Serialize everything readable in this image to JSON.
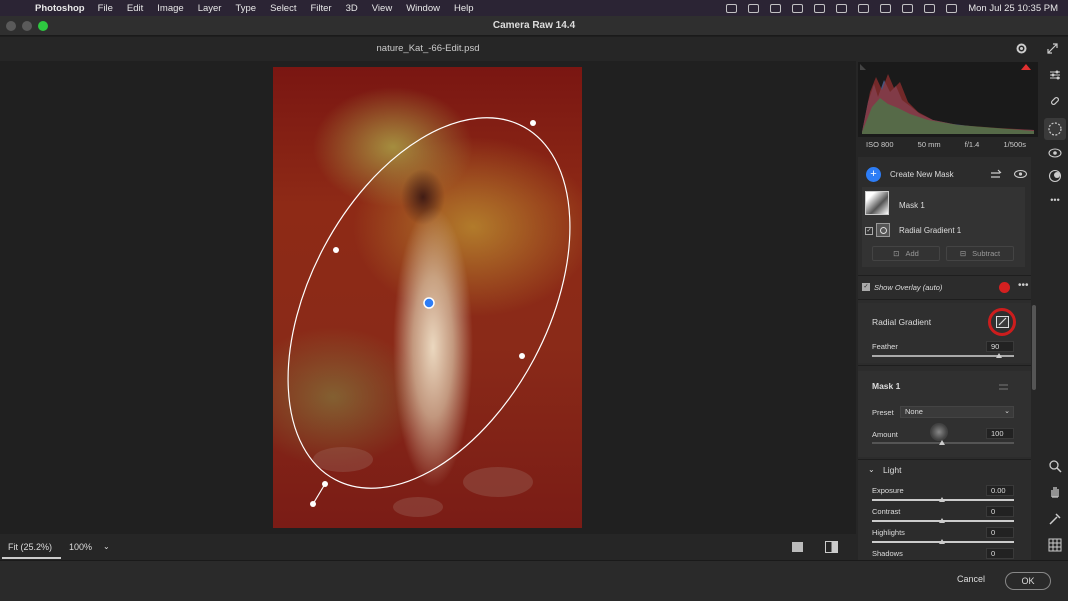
{
  "menubar": {
    "app_name": "Photoshop",
    "items": [
      "File",
      "Edit",
      "Image",
      "Layer",
      "Type",
      "Select",
      "Filter",
      "3D",
      "View",
      "Window",
      "Help"
    ],
    "clock": "Mon Jul 25  10:35 PM"
  },
  "window": {
    "title": "Camera Raw 14.4"
  },
  "document": {
    "filename": "nature_Kat_-66-Edit.psd"
  },
  "exif": {
    "iso": "ISO 800",
    "focal": "50 mm",
    "aperture": "f/1.4",
    "shutter": "1/500s"
  },
  "masks": {
    "create_label": "Create New Mask",
    "mask_name": "Mask 1",
    "component_name": "Radial Gradient 1",
    "add_label": "Add",
    "subtract_label": "Subtract",
    "show_overlay_label": "Show Overlay (auto)",
    "show_overlay_checked": true,
    "overlay_color": "#d42020"
  },
  "radial": {
    "title": "Radial Gradient",
    "feather_label": "Feather",
    "feather_value": "90"
  },
  "mask_section": {
    "title": "Mask 1",
    "preset_label": "Preset",
    "preset_value": "None",
    "amount_label": "Amount",
    "amount_value": "100"
  },
  "light": {
    "title": "Light",
    "sliders": [
      {
        "label": "Exposure",
        "value": "0.00"
      },
      {
        "label": "Contrast",
        "value": "0"
      },
      {
        "label": "Highlights",
        "value": "0"
      },
      {
        "label": "Shadows",
        "value": "0"
      }
    ]
  },
  "zoom": {
    "fit_label": "Fit (25.2%)",
    "percent_label": "100%"
  },
  "footer": {
    "cancel_label": "Cancel",
    "ok_label": "OK"
  },
  "colors": {
    "accent": "#2d7df6",
    "highlight_circle": "#cc1d1d",
    "overlay": "#8b1a14"
  }
}
